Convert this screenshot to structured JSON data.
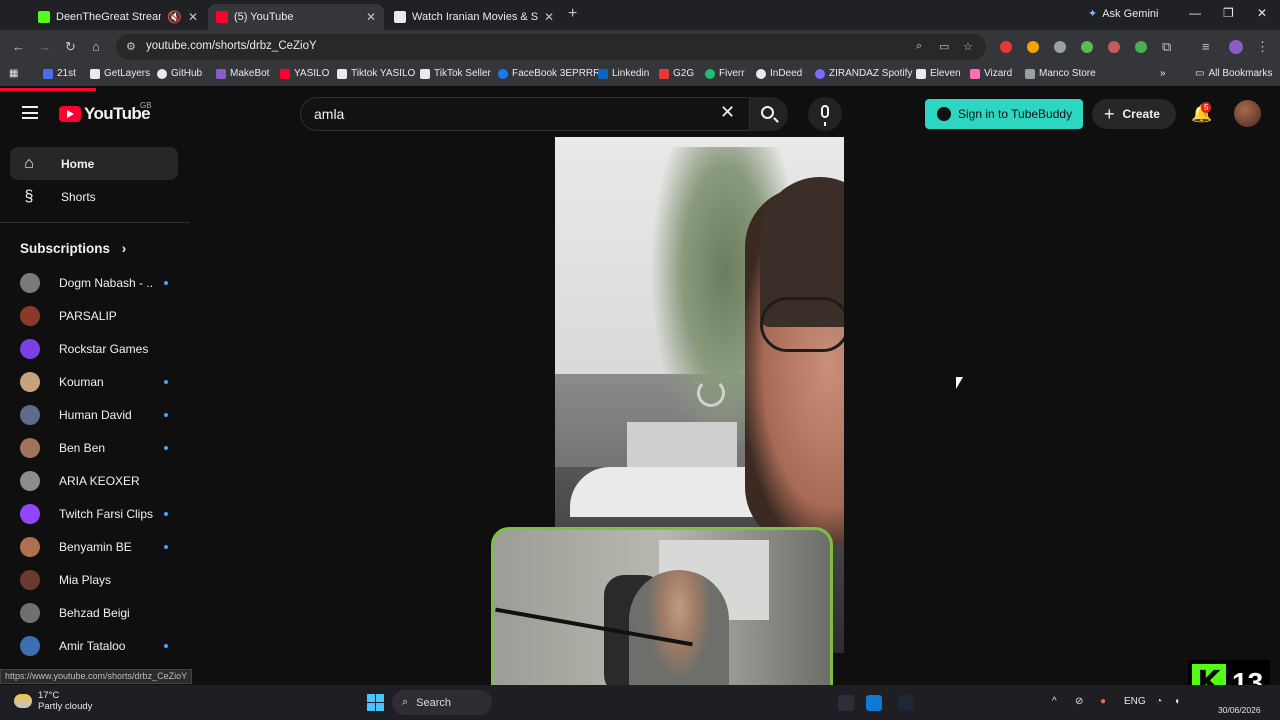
{
  "browser": {
    "tabs": [
      {
        "title": "DeenTheGreat Stream - Wa",
        "favicon_color": "#53fc18",
        "active": false
      },
      {
        "title": "(5) YouTube",
        "favicon_color": "#ff0033",
        "active": true
      },
      {
        "title": "Watch Iranian Movies & Serials",
        "favicon_color": "#e8eaed",
        "active": false
      }
    ],
    "ask_gemini": "Ask Gemini",
    "url": "youtube.com/shorts/drbz_CeZioY",
    "status_url": "https://www.youtube.com/shorts/drbz_CeZioY",
    "bookmarks": [
      {
        "label": "21st",
        "color": "#4f6bed"
      },
      {
        "label": "GetLayers",
        "color": "#e8eaed"
      },
      {
        "label": "GitHub",
        "color": "#e8eaed"
      },
      {
        "label": "MakeBot",
        "color": "#8a5cc7"
      },
      {
        "label": "YASILO",
        "color": "#ff0033"
      },
      {
        "label": "Tiktok YASILO",
        "color": "#e8eaed"
      },
      {
        "label": "TikTok Seller",
        "color": "#e8eaed"
      },
      {
        "label": "FaceBook 3EPRRR",
        "color": "#1877f2"
      },
      {
        "label": "Linkedin",
        "color": "#0a66c2"
      },
      {
        "label": "G2G",
        "color": "#e53935"
      },
      {
        "label": "Fiverr",
        "color": "#1dbf73"
      },
      {
        "label": "InDeed",
        "color": "#e8eaed"
      },
      {
        "label": "ZIRANDAZ Spotify",
        "color": "#7c6cff"
      },
      {
        "label": "Eleven",
        "color": "#e8eaed"
      },
      {
        "label": "Vizard",
        "color": "#ff6fb1"
      },
      {
        "label": "Manco Store",
        "color": "#9aa0a6"
      }
    ],
    "all_bookmarks": "All Bookmarks"
  },
  "youtube": {
    "logo_text": "YouTube",
    "region": "GB",
    "search_value": "amla",
    "tubebuddy_label": "Sign in to TubeBuddy",
    "create_label": "Create",
    "notification_count": "5",
    "sidebar": {
      "main": [
        {
          "label": "Home",
          "icon": "home-icon",
          "glyph": "⌂"
        },
        {
          "label": "Shorts",
          "icon": "shorts-icon",
          "glyph": "§"
        }
      ],
      "subscriptions_title": "Subscriptions",
      "subscriptions": [
        {
          "name": "Dogm Nabash - ...",
          "color": "#7a7a7a",
          "live": true
        },
        {
          "name": "PARSALIP",
          "color": "#8b3a2a",
          "live": false
        },
        {
          "name": "Rockstar Games",
          "color": "#7b3fe4",
          "live": false
        },
        {
          "name": "Kouman",
          "color": "#c8a27a",
          "live": true
        },
        {
          "name": "Human David",
          "color": "#5d6c8a",
          "live": true
        },
        {
          "name": "Ben Ben",
          "color": "#a0735a",
          "live": true
        },
        {
          "name": "ARIA KEOXER",
          "color": "#8d8d8d",
          "live": false
        },
        {
          "name": "Twitch Farsi Clips",
          "color": "#9146ff",
          "live": true
        },
        {
          "name": "Benyamin BE",
          "color": "#b07050",
          "live": true
        },
        {
          "name": "Mia Plays",
          "color": "#6b3a2e",
          "live": false
        },
        {
          "name": "Behzad Beigi",
          "color": "#707070",
          "live": false
        },
        {
          "name": "Amir Tataloo",
          "color": "#3a6fb0",
          "live": true
        }
      ]
    }
  },
  "overlay": {
    "channel_number": "13"
  },
  "taskbar": {
    "temperature": "17°C",
    "weather": "Partly cloudy",
    "search_label": "Search",
    "lang": "ENG",
    "date": "30/06/2026"
  }
}
